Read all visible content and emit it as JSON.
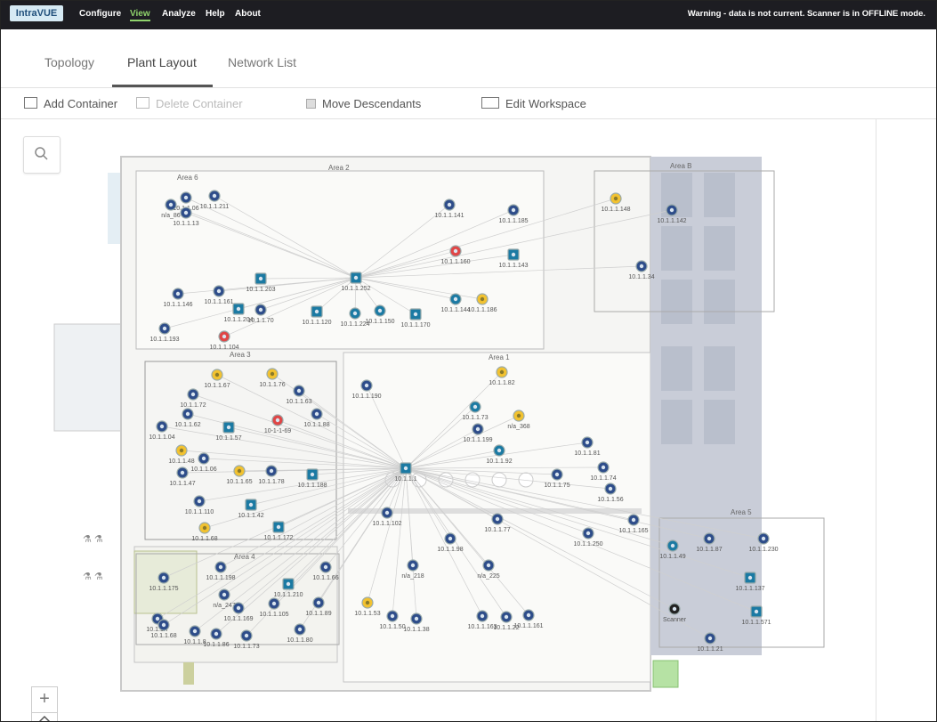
{
  "app": {
    "logo": "IntraVUE",
    "menu": [
      "Configure",
      "View",
      "Analyze",
      "Help",
      "About"
    ],
    "active_menu": "View",
    "warning": "Warning - data is not current. Scanner is in OFFLINE mode."
  },
  "tabs": [
    "Topology",
    "Plant Layout",
    "Network List"
  ],
  "active_tab": "Plant Layout",
  "toolbar": {
    "add_container": "Add Container",
    "delete_container": "Delete Container",
    "move_descendants": "Move Descendants",
    "edit_workspace": "Edit Workspace"
  },
  "areas": [
    "Area 2",
    "Area 6",
    "Area 3",
    "Area 1",
    "Area 4",
    "Area 5",
    "Area B"
  ],
  "status_colors": {
    "ok": "#2e4d8a",
    "switch": "#1b7aa3",
    "warning": "#f2c230",
    "down": "#e04646",
    "scanner": "#222222"
  },
  "devices": [
    {
      "label": "10.1.1.06"
    },
    {
      "label": "n/a_86"
    },
    {
      "label": "10.1.1.211"
    },
    {
      "label": "10.1.1.13"
    },
    {
      "label": "10.1.1.141"
    },
    {
      "label": "10.1.1.185"
    },
    {
      "label": "10.1.1.148"
    },
    {
      "label": "10.1.1.142"
    },
    {
      "label": "10.1.1.160"
    },
    {
      "label": "10.1.1.143"
    },
    {
      "label": "10.1.1.34"
    },
    {
      "label": "10.1.1.203"
    },
    {
      "label": "10.1.1.252"
    },
    {
      "label": "10.1.1.144"
    },
    {
      "label": "10.1.1.186"
    },
    {
      "label": "10.1.1.146"
    },
    {
      "label": "10.1.1.161"
    },
    {
      "label": "10.1.1.204"
    },
    {
      "label": "10.1.1.70"
    },
    {
      "label": "10.1.1.120"
    },
    {
      "label": "10.1.1.224"
    },
    {
      "label": "10.1.1.150"
    },
    {
      "label": "10.1.1.170"
    },
    {
      "label": "10.1.1.193"
    },
    {
      "label": "10.1.1.104"
    },
    {
      "label": "10.1.1.67"
    },
    {
      "label": "10.1.1.76"
    },
    {
      "label": "10.1.1.63"
    },
    {
      "label": "10.1.1.72"
    },
    {
      "label": "10.1.1.62"
    },
    {
      "label": "10-1-1-69"
    },
    {
      "label": "10.1.1.88"
    },
    {
      "label": "10.1.1.04"
    },
    {
      "label": "10.1.1.57"
    },
    {
      "label": "10.1.1.48"
    },
    {
      "label": "10.1.1.06"
    },
    {
      "label": "10.1.1.47"
    },
    {
      "label": "10.1.1.65"
    },
    {
      "label": "10.1.1.78"
    },
    {
      "label": "10.1.1.188"
    },
    {
      "label": "10.1.1.110"
    },
    {
      "label": "10.1.1.42"
    },
    {
      "label": "10.1.1.68"
    },
    {
      "label": "10.1.1.172"
    },
    {
      "label": "10.1.1.190"
    },
    {
      "label": "10.1.1.82"
    },
    {
      "label": "10.1.1.73"
    },
    {
      "label": "n/a_368"
    },
    {
      "label": "10.1.1.199"
    },
    {
      "label": "10.1.1.81"
    },
    {
      "label": "10.1.1.92"
    },
    {
      "label": "10.1.1.1"
    },
    {
      "label": "10.1.1.74"
    },
    {
      "label": "10.1.1.75"
    },
    {
      "label": "10.1.1.56"
    },
    {
      "label": "10.1.1.102"
    },
    {
      "label": "10.1.1.77"
    },
    {
      "label": "10.1.1.165"
    },
    {
      "label": "10.1.1.98"
    },
    {
      "label": "10.1.1.250"
    },
    {
      "label": "10.1.1.49"
    },
    {
      "label": "10.1.1.87"
    },
    {
      "label": "10.1.1.230"
    },
    {
      "label": "n/a_218"
    },
    {
      "label": "n/a_225"
    },
    {
      "label": "10.1.1.137"
    },
    {
      "label": "10.1.1.175"
    },
    {
      "label": "10.1.1.198"
    },
    {
      "label": "10.1.1.66"
    },
    {
      "label": "n/a_247"
    },
    {
      "label": "10.1.1.210"
    },
    {
      "label": "10.1.1.169"
    },
    {
      "label": "10.1.1.105"
    },
    {
      "label": "10.1.1.89"
    },
    {
      "label": "10.1.1.53"
    },
    {
      "label": "10.1.1.50"
    },
    {
      "label": "10.1.1.38"
    },
    {
      "label": "10.1.1.163"
    },
    {
      "label": "10.1.1.22"
    },
    {
      "label": "10.1.1.161"
    },
    {
      "label": "10.1.1.571"
    },
    {
      "label": "Scanner"
    },
    {
      "label": "10.1.1.21"
    },
    {
      "label": "10.1.1.7"
    },
    {
      "label": "10.1.1.68"
    },
    {
      "label": "10.1.1.8"
    },
    {
      "label": "10.1.1.86"
    },
    {
      "label": "10.1.1.73"
    },
    {
      "label": "10.1.1.80"
    }
  ]
}
